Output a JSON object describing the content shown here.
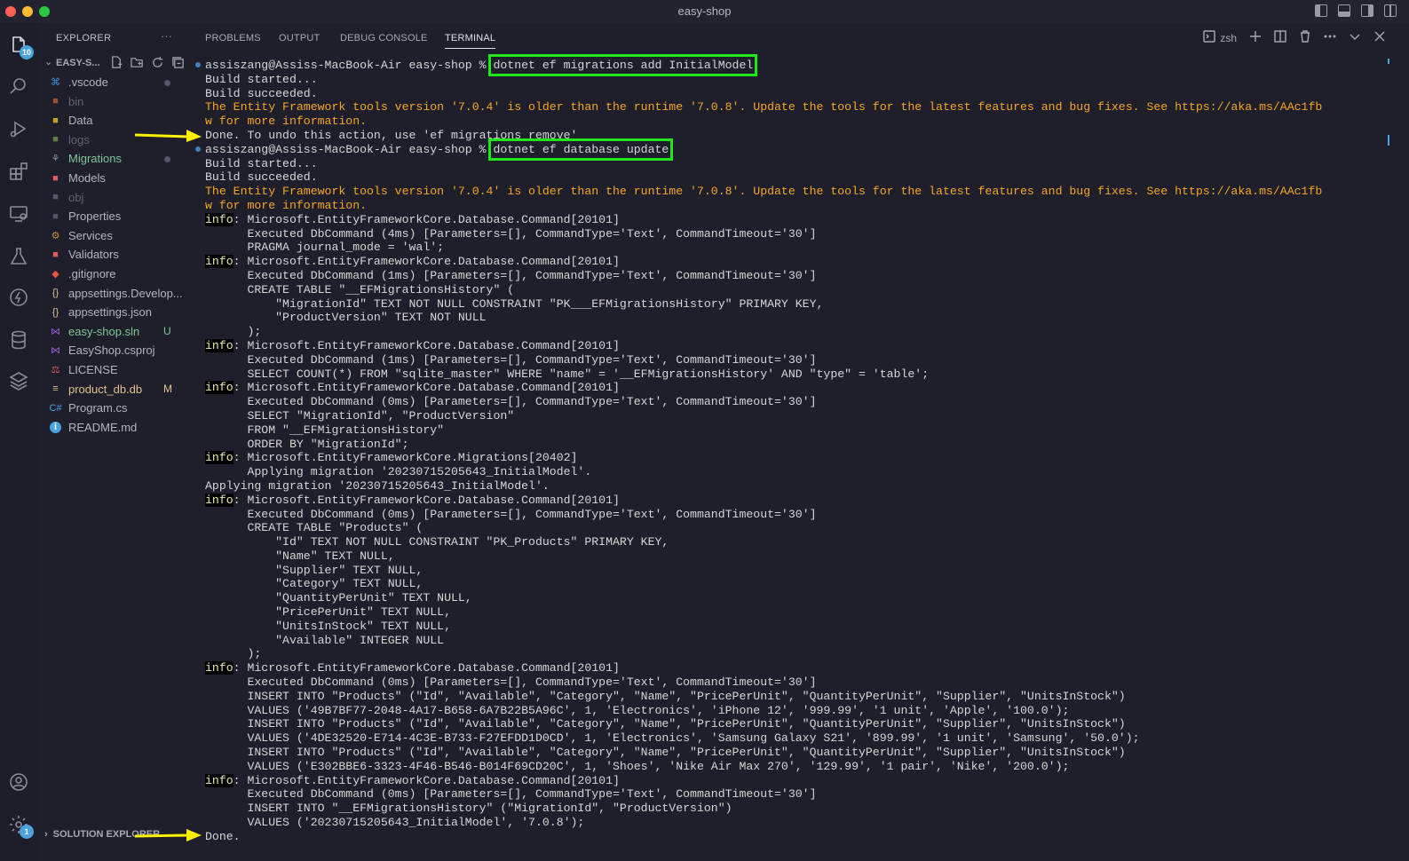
{
  "window": {
    "title": "easy-shop"
  },
  "activity_bar": {
    "explorer_badge": "10",
    "settings_badge": "1"
  },
  "sidebar": {
    "header": "EXPLORER",
    "more": "···",
    "folder": "EASY-S...",
    "items": [
      {
        "label": ".vscode",
        "icon": "vscode-folder-icon",
        "style": "normal",
        "status": "dot"
      },
      {
        "label": "bin",
        "icon": "bin-folder-icon",
        "style": "dim",
        "status": ""
      },
      {
        "label": "Data",
        "icon": "data-folder-icon",
        "style": "normal",
        "status": ""
      },
      {
        "label": "logs",
        "icon": "logs-folder-icon",
        "style": "dim",
        "status": ""
      },
      {
        "label": "Migrations",
        "icon": "migrations-folder-icon",
        "style": "green",
        "status": "dot"
      },
      {
        "label": "Models",
        "icon": "models-folder-icon",
        "style": "normal",
        "status": ""
      },
      {
        "label": "obj",
        "icon": "obj-folder-icon",
        "style": "dim",
        "status": ""
      },
      {
        "label": "Properties",
        "icon": "properties-folder-icon",
        "style": "normal",
        "status": ""
      },
      {
        "label": "Services",
        "icon": "services-folder-icon",
        "style": "normal",
        "status": ""
      },
      {
        "label": "Validators",
        "icon": "validators-folder-icon",
        "style": "normal",
        "status": ""
      },
      {
        "label": ".gitignore",
        "icon": "git-icon",
        "style": "normal",
        "status": ""
      },
      {
        "label": "appsettings.Develop...",
        "icon": "json-icon",
        "style": "normal",
        "status": ""
      },
      {
        "label": "appsettings.json",
        "icon": "json-icon",
        "style": "normal",
        "status": ""
      },
      {
        "label": "easy-shop.sln",
        "icon": "visual-studio-icon",
        "style": "green",
        "status": "U"
      },
      {
        "label": "EasyShop.csproj",
        "icon": "visual-studio-icon",
        "style": "normal",
        "status": ""
      },
      {
        "label": "LICENSE",
        "icon": "license-icon",
        "style": "normal",
        "status": ""
      },
      {
        "label": "product_db.db",
        "icon": "database-icon",
        "style": "gold",
        "status": "M"
      },
      {
        "label": "Program.cs",
        "icon": "csharp-icon",
        "style": "normal",
        "status": ""
      },
      {
        "label": "README.md",
        "icon": "info-icon",
        "style": "normal",
        "status": ""
      }
    ],
    "bottom_section": "SOLUTION EXPLORER"
  },
  "panel": {
    "tabs": [
      "PROBLEMS",
      "OUTPUT",
      "DEBUG CONSOLE",
      "TERMINAL"
    ],
    "active_tab": "TERMINAL",
    "shell": "zsh"
  },
  "terminal": {
    "prompt": "assiszang@Assiss-MacBook-Air easy-shop % ",
    "cmd1": "dotnet ef migrations add InitialModel",
    "cmd2": "dotnet ef database update",
    "info_tag": "info",
    "lines": {
      "build_started": "Build started...",
      "build_succeeded": "Build succeeded.",
      "warn_a": "The Entity Framework tools version '7.0.4' is older than the runtime '7.0.8'. Update the tools for the latest features and bug fixes. See https://aka.ms/AAc1fb",
      "warn_b": "w for more information.",
      "done_undo": "Done. To undo this action, use 'ef migrations remove'",
      "cmd_20101": ": Microsoft.EntityFrameworkCore.Database.Command[20101]",
      "exec_4ms": "      Executed DbCommand (4ms) [Parameters=[], CommandType='Text', CommandTimeout='30']",
      "pragma": "      PRAGMA journal_mode = 'wal';",
      "exec_1ms": "      Executed DbCommand (1ms) [Parameters=[], CommandType='Text', CommandTimeout='30']",
      "create_hist": "      CREATE TABLE \"__EFMigrationsHistory\" (",
      "hist_col1": "          \"MigrationId\" TEXT NOT NULL CONSTRAINT \"PK___EFMigrationsHistory\" PRIMARY KEY,",
      "hist_col2": "          \"ProductVersion\" TEXT NOT NULL",
      "close_paren": "      );",
      "select_count": "      SELECT COUNT(*) FROM \"sqlite_master\" WHERE \"name\" = '__EFMigrationsHistory' AND \"type\" = 'table';",
      "exec_0ms": "      Executed DbCommand (0ms) [Parameters=[], CommandType='Text', CommandTimeout='30']",
      "select_mig": "      SELECT \"MigrationId\", \"ProductVersion\"",
      "from_hist": "      FROM \"__EFMigrationsHistory\"",
      "order_by": "      ORDER BY \"MigrationId\";",
      "mig_20402": ": Microsoft.EntityFrameworkCore.Migrations[20402]",
      "applying_indent": "      Applying migration '20230715205643_InitialModel'.",
      "applying": "Applying migration '20230715205643_InitialModel'.",
      "create_products": "      CREATE TABLE \"Products\" (",
      "p_id": "          \"Id\" TEXT NOT NULL CONSTRAINT \"PK_Products\" PRIMARY KEY,",
      "p_name": "          \"Name\" TEXT NULL,",
      "p_supplier": "          \"Supplier\" TEXT NULL,",
      "p_category": "          \"Category\" TEXT NULL,",
      "p_qty": "          \"QuantityPerUnit\" TEXT NULL,",
      "p_price": "          \"PricePerUnit\" TEXT NULL,",
      "p_units": "          \"UnitsInStock\" TEXT NULL,",
      "p_avail": "          \"Available\" INTEGER NULL",
      "insert_products": "      INSERT INTO \"Products\" (\"Id\", \"Available\", \"Category\", \"Name\", \"PricePerUnit\", \"QuantityPerUnit\", \"Supplier\", \"UnitsInStock\")",
      "values_1": "      VALUES ('49B7BF77-2048-4A17-B658-6A7B22B5A96C', 1, 'Electronics', 'iPhone 12', '999.99', '1 unit', 'Apple', '100.0');",
      "values_2": "      VALUES ('4DE32520-E714-4C3E-B733-F27EFDD1D0CD', 1, 'Electronics', 'Samsung Galaxy S21', '899.99', '1 unit', 'Samsung', '50.0');",
      "values_3": "      VALUES ('E302BBE6-3323-4F46-B546-B014F69CD20C', 1, 'Shoes', 'Nike Air Max 270', '129.99', '1 pair', 'Nike', '200.0');",
      "insert_hist": "      INSERT INTO \"__EFMigrationsHistory\" (\"MigrationId\", \"ProductVersion\")",
      "values_hist": "      VALUES ('20230715205643_InitialModel', '7.0.8');",
      "done": "Done."
    }
  },
  "colors": {
    "highlight_box": "#22e51c",
    "annotation_arrow": "#ffef00",
    "warning_text": "#f5a623"
  }
}
